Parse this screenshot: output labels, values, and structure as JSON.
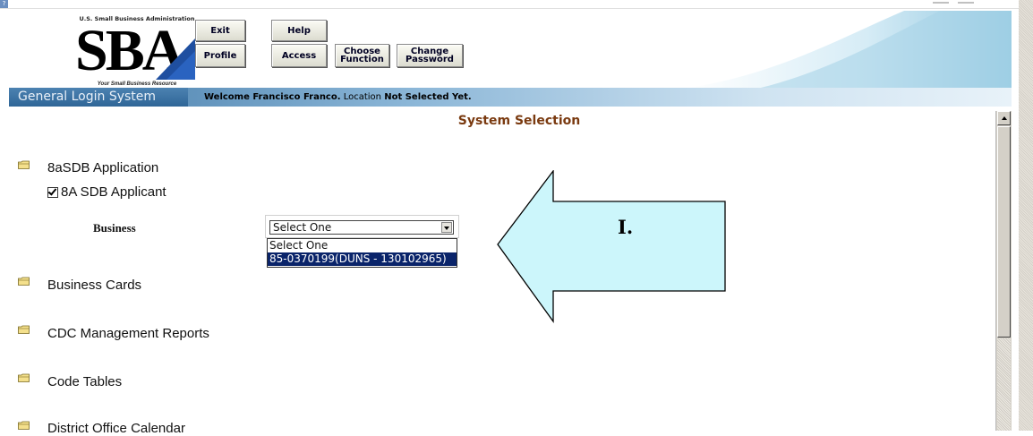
{
  "header": {
    "logo_top": "U.S. Small Business Administration",
    "logo_letters": "SBA",
    "logo_tagline": "Your Small Business Resource",
    "buttons": {
      "exit": "Exit",
      "help": "Help",
      "profile": "Profile",
      "access": "Access",
      "choose_function_line1": "Choose",
      "choose_function_line2": "Function",
      "change_password_line1": "Change",
      "change_password_line2": "Password"
    }
  },
  "navbar": {
    "title": "General Login System",
    "welcome_prefix": "Welcome Francisco Franco.",
    "location_label": "Location",
    "location_value": "Not Selected Yet."
  },
  "page": {
    "title": "System Selection"
  },
  "systems": [
    {
      "label": "8aSDB Application"
    },
    {
      "label": "Business Cards"
    },
    {
      "label": "CDC Management Reports"
    },
    {
      "label": "Code Tables"
    },
    {
      "label": "District Office Calendar"
    }
  ],
  "subitem": {
    "label": "8A SDB Applicant",
    "checked": true
  },
  "business": {
    "label": "Business",
    "selected": "Select One",
    "options": [
      "Select One",
      "85-0370199(DUNS - 130102965)"
    ],
    "highlighted_index": 1
  },
  "callout": {
    "label": "I.",
    "fill_color": "#ccf6fb"
  },
  "colors": {
    "navbar_dark": "#2f6697",
    "title_brown": "#7a3a10",
    "selection_highlight": "#0a246a"
  }
}
